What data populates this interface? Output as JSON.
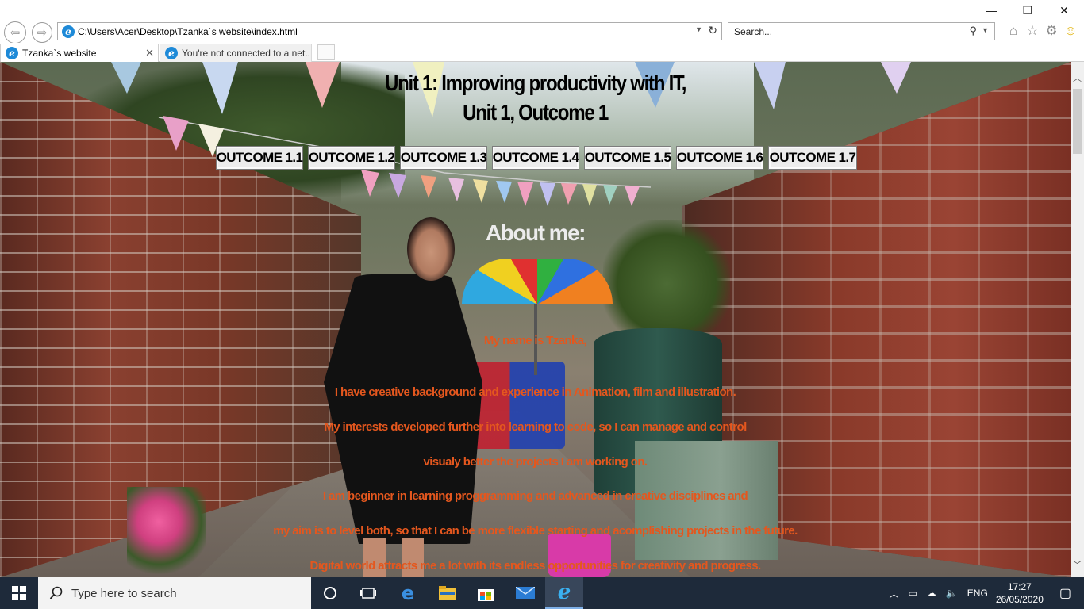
{
  "window": {
    "controls": {
      "minimize": "—",
      "restore": "❐",
      "close": "✕"
    }
  },
  "toolbar": {
    "address": "C:\\Users\\Acer\\Desktop\\Tzanka`s website\\index.html",
    "search_placeholder": "Search..."
  },
  "tabs": [
    {
      "title": "Tzanka`s website",
      "active": true
    },
    {
      "title": "You're not connected to a net...",
      "active": false
    }
  ],
  "page": {
    "title_line1": "Unit 1: Improving productivity with IT,",
    "title_line2": "Unit 1, Outcome 1",
    "outcomes": [
      "OUTCOME 1.1",
      "OUTCOME 1.2",
      "OUTCOME 1.3",
      "OUTCOME 1.4",
      "OUTCOME 1.5",
      "OUTCOME 1.6",
      "OUTCOME 1.7"
    ],
    "about_heading": "About me:",
    "bio": [
      "My name is Tzanka,",
      "I have creative background and experience in Animation, film and illustration.",
      "My interests developed further into learning to code, so I can manage and control",
      "visualy better the projects I am working on.",
      "I am beginner in learning proggramming and advanced in creative disciplines and",
      "my aim is to level both, so that I can be more flexible starting and acomplishing projects in the future.",
      "Digital world attracts me a lot with its endless opportunities for creativity and progress."
    ],
    "bio_color": "#e4571e",
    "heading_color": "#ececec"
  },
  "taskbar": {
    "search_placeholder": "Type here to search",
    "language": "ENG",
    "time": "17:27",
    "date": "26/05/2020"
  }
}
